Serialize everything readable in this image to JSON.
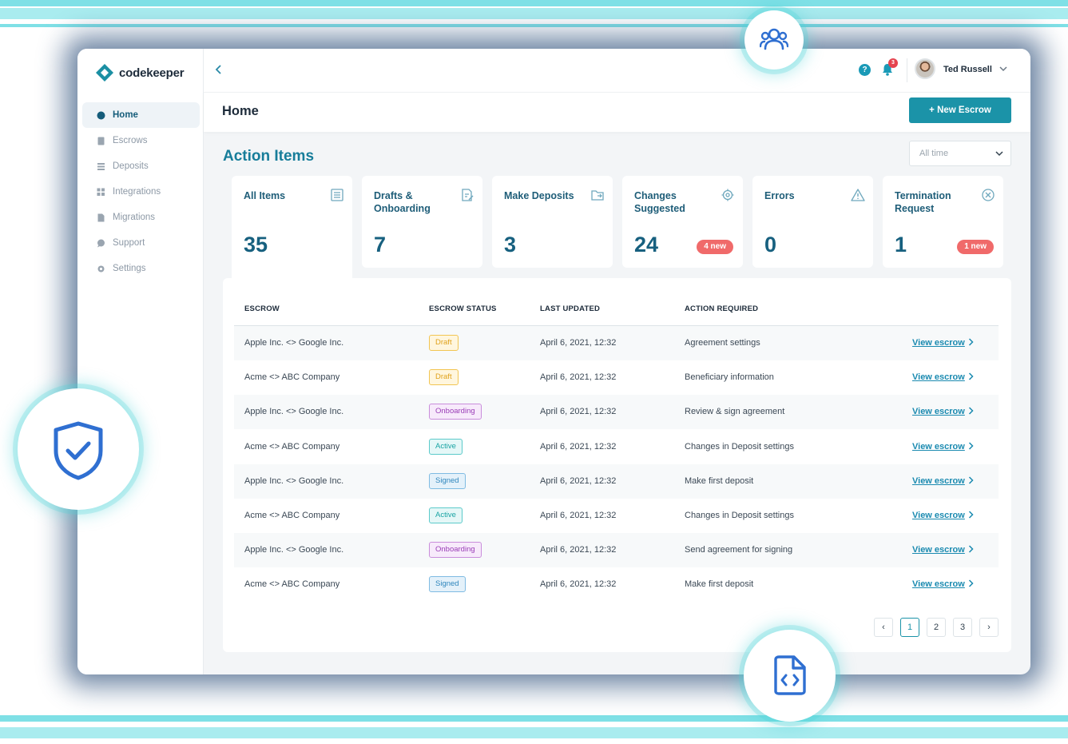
{
  "brand": {
    "name": "codekeeper",
    "accent": "#1b93a8",
    "title_color": "#177d9a"
  },
  "sidebar": {
    "items": [
      {
        "label": "Home",
        "icon": "home-icon",
        "active": true
      },
      {
        "label": "Escrows",
        "icon": "document-icon",
        "active": false
      },
      {
        "label": "Deposits",
        "icon": "list-icon",
        "active": false
      },
      {
        "label": "Integrations",
        "icon": "grid-icon",
        "active": false
      },
      {
        "label": "Migrations",
        "icon": "file-icon",
        "active": false
      },
      {
        "label": "Support",
        "icon": "chat-icon",
        "active": false
      },
      {
        "label": "Settings",
        "icon": "gear-icon",
        "active": false
      }
    ]
  },
  "header": {
    "collapse_icon": "chevron-left-icon",
    "notifications_count": "3",
    "help_glyph": "?",
    "user_name": "Ted Russell"
  },
  "page": {
    "title": "Home",
    "new_button": "+ New Escrow",
    "section_title": "Action Items",
    "time_filter": "All time"
  },
  "cards": [
    {
      "label": "All Items",
      "value": "35",
      "badge": "",
      "icon": "list-icon"
    },
    {
      "label": "Drafts & Onboarding",
      "value": "7",
      "badge": "",
      "icon": "edit-document-icon"
    },
    {
      "label": "Make Deposits",
      "value": "3",
      "badge": "",
      "icon": "folder-icon"
    },
    {
      "label": "Changes Suggested",
      "value": "24",
      "badge": "4 new",
      "icon": "gear-icon"
    },
    {
      "label": "Errors",
      "value": "0",
      "badge": "",
      "icon": "warning-icon"
    },
    {
      "label": "Termination Request",
      "value": "1",
      "badge": "1 new",
      "icon": "close-circle-icon"
    }
  ],
  "table": {
    "headers": [
      "ESCROW",
      "ESCROW STATUS",
      "LAST UPDATED",
      "ACTION REQUIRED"
    ],
    "rows": [
      {
        "escrow": "Apple Inc. <> Google Inc.",
        "status": "Draft",
        "updated": "April 6, 2021, 12:32",
        "action": "Agreement settings",
        "link": "View escrow"
      },
      {
        "escrow": "Acme <> ABC Company",
        "status": "Draft",
        "updated": "April 6, 2021, 12:32",
        "action": "Beneficiary information",
        "link": "View escrow"
      },
      {
        "escrow": "Apple Inc. <> Google Inc.",
        "status": "Onboarding",
        "updated": "April 6, 2021, 12:32",
        "action": "Review & sign agreement",
        "link": "View escrow"
      },
      {
        "escrow": "Acme <> ABC Company",
        "status": "Active",
        "updated": "April 6, 2021, 12:32",
        "action": "Changes in Deposit settings",
        "link": "View escrow"
      },
      {
        "escrow": "Apple Inc. <> Google Inc.",
        "status": "Signed",
        "updated": "April 6, 2021, 12:32",
        "action": "Make first deposit",
        "link": "View escrow"
      },
      {
        "escrow": "Acme <> ABC Company",
        "status": "Active",
        "updated": "April 6, 2021, 12:32",
        "action": "Changes in Deposit settings",
        "link": "View escrow"
      },
      {
        "escrow": "Apple Inc. <> Google Inc.",
        "status": "Onboarding",
        "updated": "April 6, 2021, 12:32",
        "action": "Send agreement for signing",
        "link": "View escrow"
      },
      {
        "escrow": "Acme <> ABC Company",
        "status": "Signed",
        "updated": "April 6, 2021, 12:32",
        "action": "Make first deposit",
        "link": "View escrow"
      }
    ]
  },
  "pagination": {
    "prev": "‹",
    "pages": [
      "1",
      "2",
      "3"
    ],
    "current": "1",
    "next": "›"
  },
  "decorations": {
    "top_bubble": "users-icon",
    "left_bubble": "shield-check-icon",
    "bottom_bubble": "code-file-icon"
  }
}
